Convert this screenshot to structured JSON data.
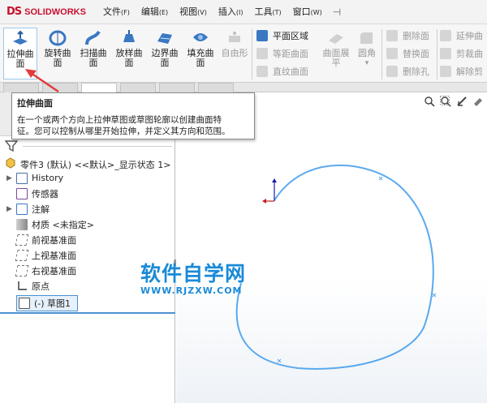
{
  "app": {
    "brand_mark": "DS",
    "brand_name": "SOLIDWORKS"
  },
  "menubar": {
    "items": [
      {
        "label": "文件",
        "key": "(F)"
      },
      {
        "label": "编辑",
        "key": "(E)"
      },
      {
        "label": "视图",
        "key": "(V)"
      },
      {
        "label": "插入",
        "key": "(I)"
      },
      {
        "label": "工具",
        "key": "(T)"
      },
      {
        "label": "窗口",
        "key": "(W)"
      }
    ]
  },
  "ribbon": {
    "buttons": [
      {
        "label_line1": "拉伸曲",
        "label_line2": "面"
      },
      {
        "label_line1": "旋转曲",
        "label_line2": "面"
      },
      {
        "label_line1": "扫描曲",
        "label_line2": "面"
      },
      {
        "label_line1": "放样曲",
        "label_line2": "面"
      },
      {
        "label_line1": "边界曲",
        "label_line2": "面"
      },
      {
        "label_line1": "填充曲",
        "label_line2": "面"
      },
      {
        "label_line1": "自由形",
        "label_line2": ""
      }
    ],
    "mid_items": [
      "平面区域",
      "等距曲面",
      "直纹曲面"
    ],
    "expand_item": {
      "line1": "曲面展",
      "line2": "平"
    },
    "fillet_item": "圆角",
    "delete_items": [
      "删除面",
      "替换面",
      "删除孔"
    ],
    "extend_items": [
      "延伸曲",
      "剪裁曲",
      "解除剪"
    ]
  },
  "tooltip": {
    "title": "拉伸曲面",
    "line1": "在一个或两个方向上拉伸草图或草图轮廓以创建曲面特",
    "line2": "征。您可以控制从哪里开始拉伸，并定义其方向和范围。"
  },
  "tree": {
    "root": "零件3 (默认) <<默认>_显示状态 1>",
    "items": [
      {
        "label": "History",
        "expandable": true
      },
      {
        "label": "传感器",
        "expandable": false
      },
      {
        "label": "注解",
        "expandable": true
      },
      {
        "label": "材质 <未指定>",
        "expandable": false
      },
      {
        "label": "前视基准面",
        "expandable": false
      },
      {
        "label": "上视基准面",
        "expandable": false
      },
      {
        "label": "右视基准面",
        "expandable": false
      },
      {
        "label": "原点",
        "expandable": false
      },
      {
        "label": "(-) 草图1",
        "expandable": false
      }
    ]
  },
  "watermark": {
    "main": "软件自学网",
    "sub": "WWW.RJZXW.COM"
  },
  "colors": {
    "brand": "#c8102e",
    "sketch_curve": "#5aa9ee",
    "selection": "#4a90d0",
    "watermark": "#1a8ad6",
    "arrow": "#e23b3b"
  }
}
